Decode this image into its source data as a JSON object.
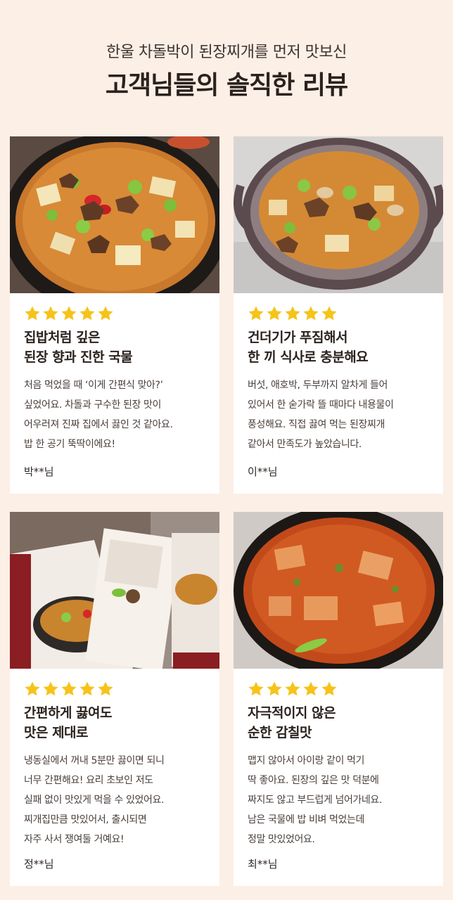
{
  "header": {
    "subtitle": "한울 차돌박이 된장찌개를 먼저 맛보신",
    "title": "고객님들의 솔직한 리뷰"
  },
  "colors": {
    "background": "#fcefe6",
    "star": "#f6c31a",
    "card": "#ffffff"
  },
  "reviews": [
    {
      "rating": 5,
      "image": "doenjang-jjigae-in-earthen-pot",
      "title_lines": [
        "집밥처럼 깊은",
        "된장 향과 진한 국물"
      ],
      "body_lines": [
        "처음 먹었을 때 ‘이게 간편식 맞아?’",
        "싶었어요. 차돌과 구수한 된장 맛이",
        "어우러져 진짜 집에서 끓인 것 같아요.",
        "밥 한 공기 뚝딱이에요!"
      ],
      "author": "박**님"
    },
    {
      "rating": 5,
      "image": "doenjang-jjigae-in-gray-pot",
      "title_lines": [
        "건더기가 푸짐해서",
        "한 끼 식사로 충분해요"
      ],
      "body_lines": [
        "버섯, 애호박, 두부까지 알차게 들어",
        "있어서 한 숟가락 뜰 때마다 내용물이",
        "풍성해요. 직접 끓여 먹는 된장찌개",
        "같아서 만족도가 높았습니다."
      ],
      "author": "이**님"
    },
    {
      "rating": 5,
      "image": "product-package",
      "title_lines": [
        "간편하게 끓여도",
        "맛은 제대로"
      ],
      "body_lines": [
        "냉동실에서 꺼내 5분만 끓이면 되니",
        "너무 간편해요! 요리 초보인 저도",
        "실패 없이 맛있게 먹을 수 있었어요.",
        "찌개집만큼 맛있어서, 출시되면",
        "자주 사서 쟁여둘 거예요!"
      ],
      "author": "정**님"
    },
    {
      "rating": 5,
      "image": "spicy-stew-in-pot",
      "title_lines": [
        "자극적이지 않은",
        "순한 감칠맛"
      ],
      "body_lines": [
        "맵지 않아서 아이랑 같이 먹기",
        "딱 좋아요. 된장의 깊은 맛 덕분에",
        "짜지도 않고 부드럽게 넘어가네요.",
        "남은 국물에 밥 비벼 먹었는데",
        "정말 맛있었어요."
      ],
      "author": "최**님"
    }
  ]
}
